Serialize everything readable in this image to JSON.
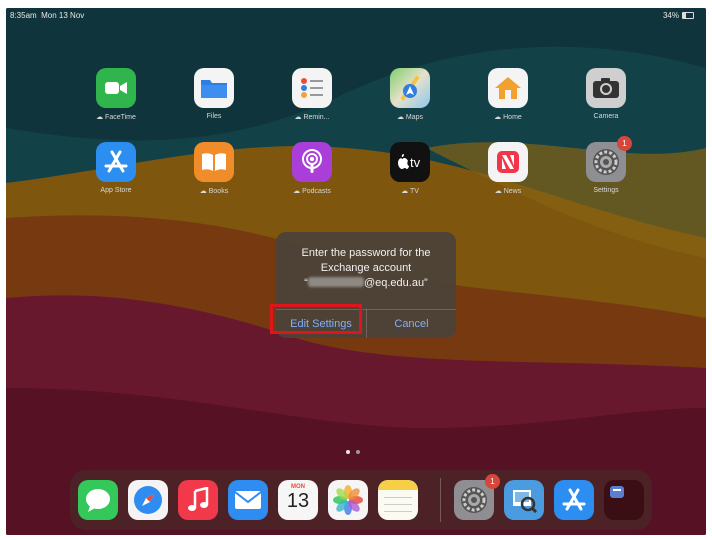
{
  "status_bar": {
    "time": "8:35am",
    "date": "Mon 13 Nov",
    "battery": "34%",
    "battery_level": 0.34
  },
  "home_apps": [
    {
      "label": "FaceTime",
      "icon": "facetime-icon",
      "cloud": true
    },
    {
      "label": "Files",
      "icon": "files-icon",
      "cloud": false
    },
    {
      "label": "Remin...",
      "icon": "reminders-icon",
      "cloud": true
    },
    {
      "label": "Maps",
      "icon": "maps-icon",
      "cloud": true
    },
    {
      "label": "Home",
      "icon": "home-icon",
      "cloud": true
    },
    {
      "label": "Camera",
      "icon": "camera-icon",
      "cloud": false
    },
    {
      "label": "App Store",
      "icon": "app-store-icon",
      "cloud": false
    },
    {
      "label": "Books",
      "icon": "books-icon",
      "cloud": true
    },
    {
      "label": "Podcasts",
      "icon": "podcasts-icon",
      "cloud": true
    },
    {
      "label": "TV",
      "icon": "tv-icon",
      "cloud": true
    },
    {
      "label": "News",
      "icon": "news-icon",
      "cloud": true
    },
    {
      "label": "Settings",
      "icon": "settings-icon",
      "cloud": false,
      "badge": "1"
    }
  ],
  "dialog": {
    "line1": "Enter the password for the",
    "line2": "Exchange account",
    "email_prefix": "“",
    "email_domain": "@eq.edu.au”",
    "edit_settings": "Edit Settings",
    "cancel": "Cancel"
  },
  "dock": {
    "calendar_month": "MON",
    "calendar_day": "13",
    "settings_badge": "1",
    "apps": [
      "messages-icon",
      "safari-icon",
      "music-icon",
      "mail-icon",
      "calendar-icon",
      "photos-icon",
      "notes-icon",
      "settings-icon",
      "preview-icon",
      "app-store-icon",
      "recent-app-icon"
    ]
  },
  "colors": {
    "highlight": "#e0141d",
    "button_text": "#7fb0ff",
    "badge": "#d8453b"
  }
}
